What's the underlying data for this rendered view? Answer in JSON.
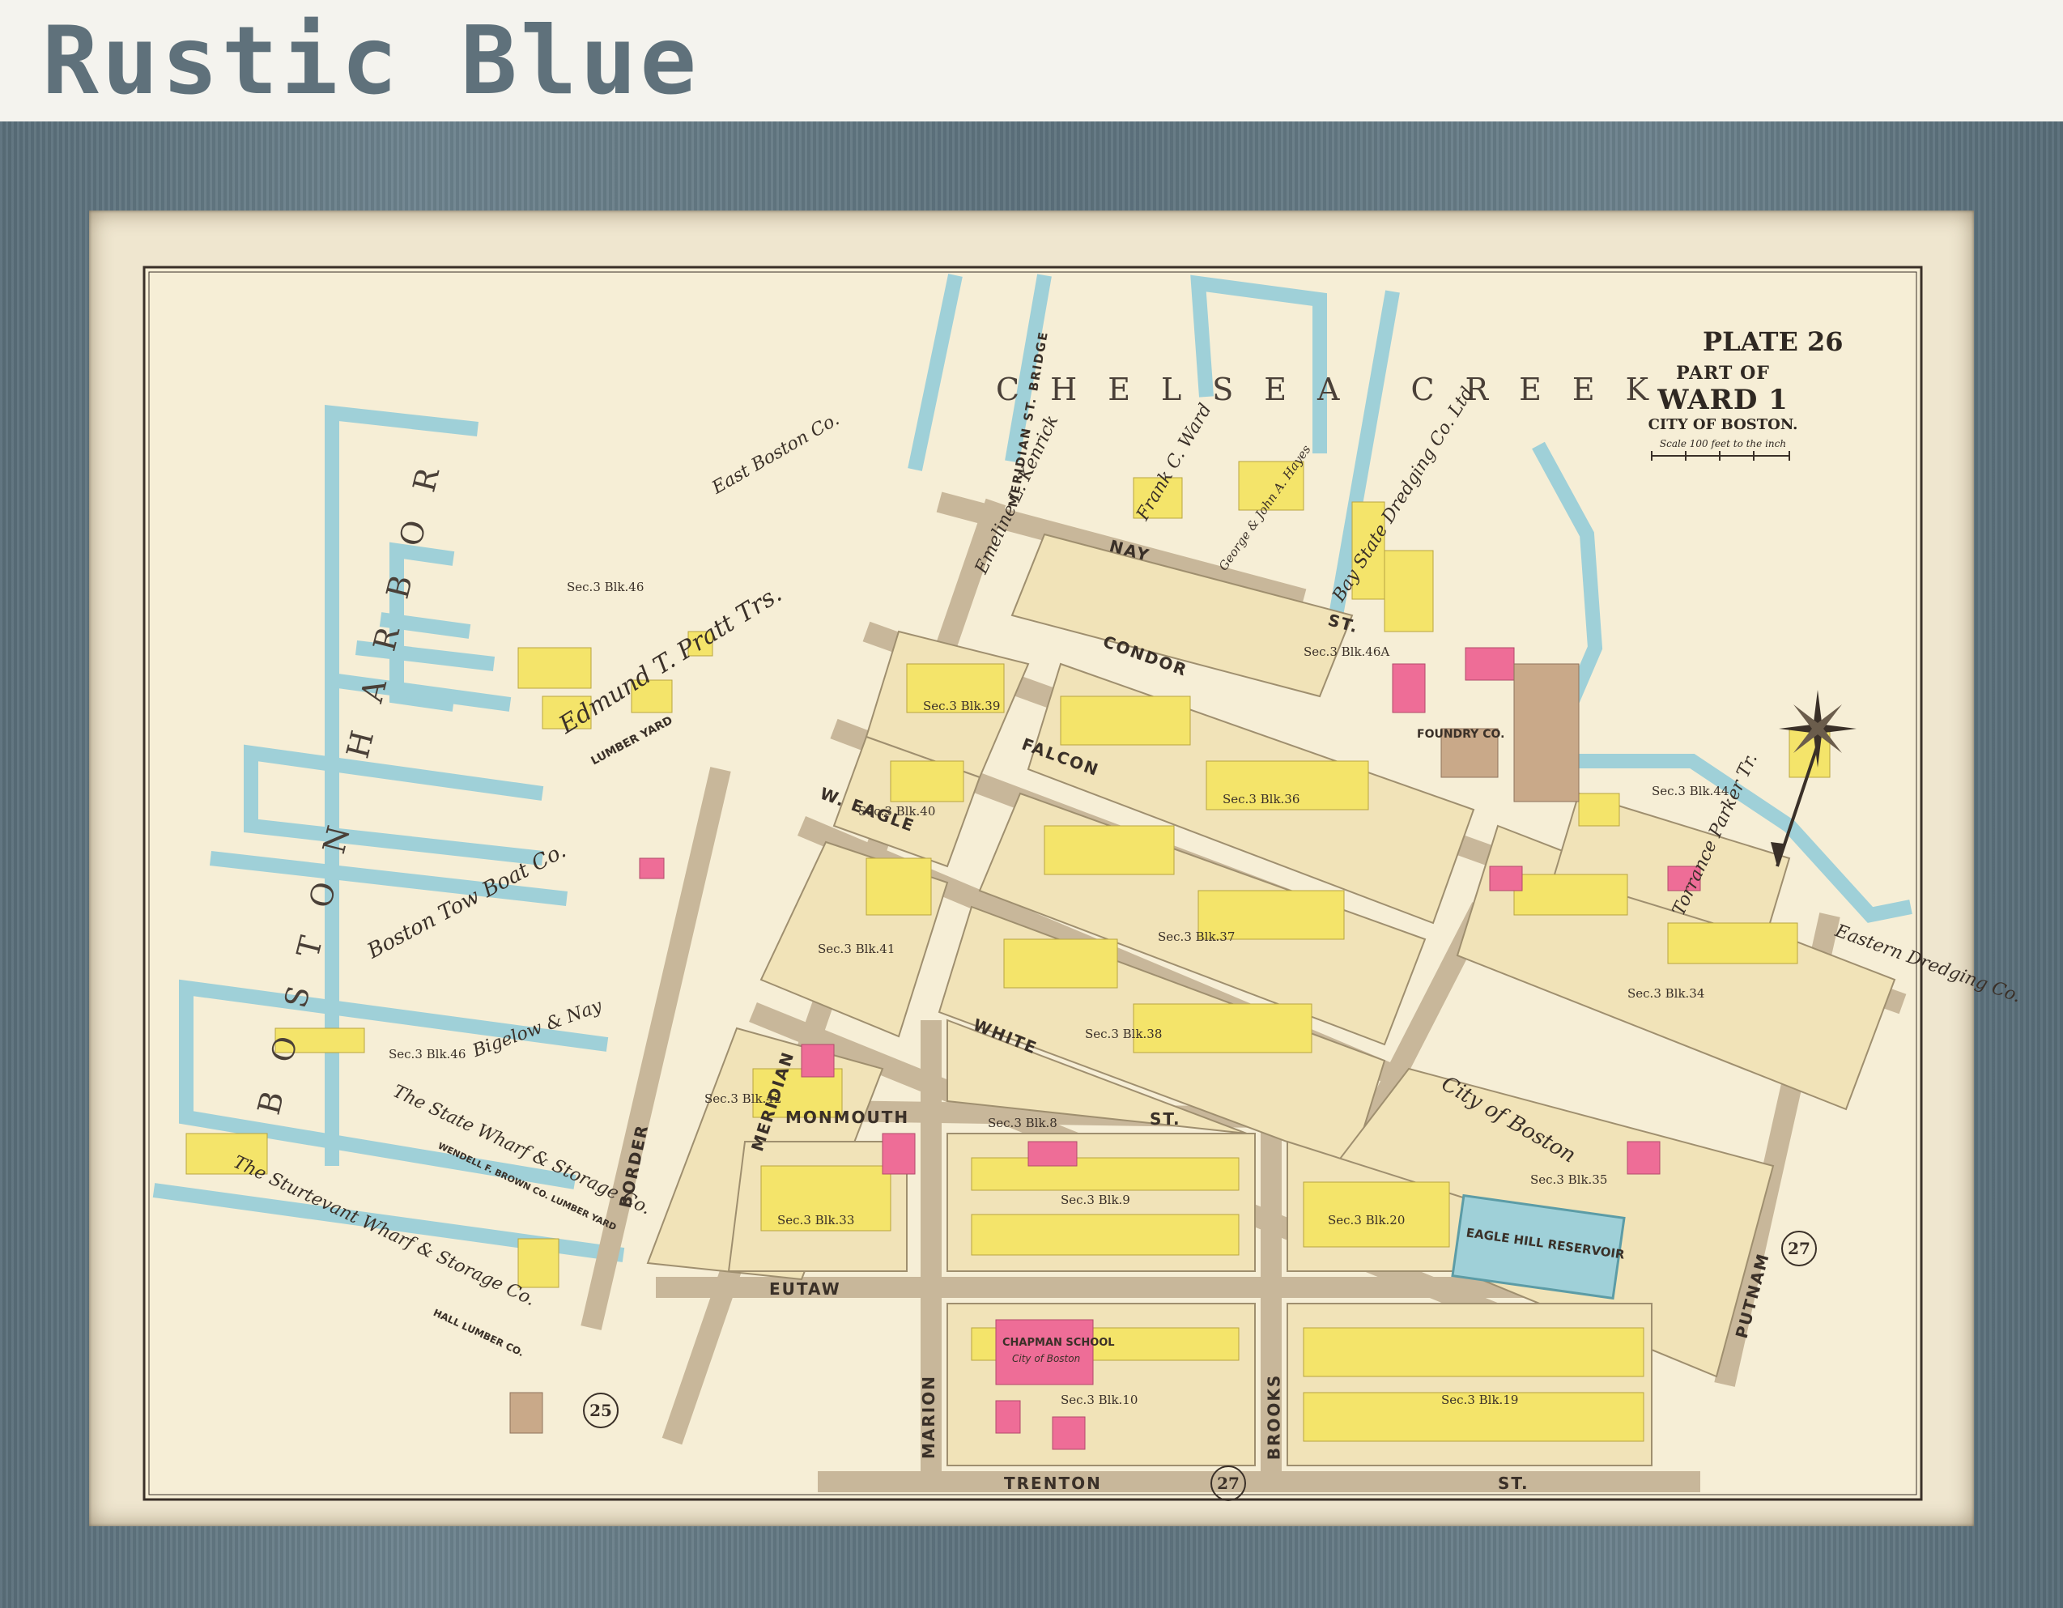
{
  "heading": "Rustic Blue",
  "map": {
    "plate": "PLATE 26",
    "title": {
      "part_of": "PART OF",
      "ward": "WARD 1",
      "city": "CITY OF BOSTON.",
      "scale": "Scale 100 feet to the inch"
    },
    "water_bodies": {
      "chelsea_creek": "CHELSEA CREEK",
      "boston_harbor": "BOSTON HARBOR"
    },
    "streets": {
      "nay": "NAY",
      "st_nay": "ST.",
      "condor": "CONDOR",
      "falcon": "FALCON",
      "w_eagle": "W. EAGLE",
      "white": "WHITE",
      "monmouth": "MONMOUTH",
      "st_monmouth": "ST.",
      "eutaw": "EUTAW",
      "trenton": "TRENTON",
      "st_trenton": "ST.",
      "border": "BORDER",
      "meridian": "MERIDIAN",
      "marion": "MARION",
      "brooks": "BROOKS",
      "putnam": "PUTNAM",
      "meridian_bridge": "MERIDIAN ST. BRIDGE",
      "st_generic": "ST."
    },
    "sections": {
      "s46_top": "Sec.3 Blk.46",
      "s46_bottom": "Sec.3 Blk.46",
      "s46a": "Sec.3 Blk.46A",
      "s39": "Sec.3 Blk.39",
      "s40": "Sec.3 Blk.40",
      "s36": "Sec.3 Blk.36",
      "s41": "Sec.3 Blk.41",
      "s37": "Sec.3 Blk.37",
      "s38": "Sec.3 Blk.38",
      "s34": "Sec.3 Blk.34",
      "s35": "Sec.3 Blk.35",
      "s42": "Sec.3 Blk.42",
      "s8": "Sec.3 Blk.8",
      "s9": "Sec.3 Blk.9",
      "s20": "Sec.3 Blk.20",
      "s10": "Sec.3 Blk.10",
      "s19": "Sec.3 Blk.19",
      "s33": "Sec.3 Blk.33",
      "s44": "Sec.3 Blk.44"
    },
    "owners": {
      "east_boston_co": "East Boston Co.",
      "pratt": "Edmund T. Pratt Trs.",
      "kenrick": "Emeline L. Kenrick",
      "ward": "Frank C. Ward",
      "hayes": "George & John A. Hayes",
      "bay_state": "Bay State Dredging Co. Ltd",
      "boston_tow": "Boston Tow Boat Co.",
      "bigelow": "Bigelow & Nay",
      "state_wharf": "The State Wharf & Storage Co.",
      "sturtevant": "The Sturtevant Wharf & Storage Co.",
      "city_of_boston": "City of Boston",
      "torrance": "Torrance Parker Tr.",
      "eastern_dredging": "Eastern Dredging Co."
    },
    "buildings": {
      "lumber_yard": "LUMBER YARD",
      "eagle_hill_reservoir": "EAGLE HILL RESERVOIR",
      "chapman_school": "CHAPMAN SCHOOL",
      "chapman_school_sub": "City of Boston",
      "foundry": "FOUNDRY CO.",
      "wendell": "WENDELL F. BROWN CO. LUMBER YARD",
      "hall_lumber": "HALL LUMBER CO."
    },
    "adjacent_plates": {
      "left": "25",
      "right": "27",
      "bottom": "27"
    }
  }
}
